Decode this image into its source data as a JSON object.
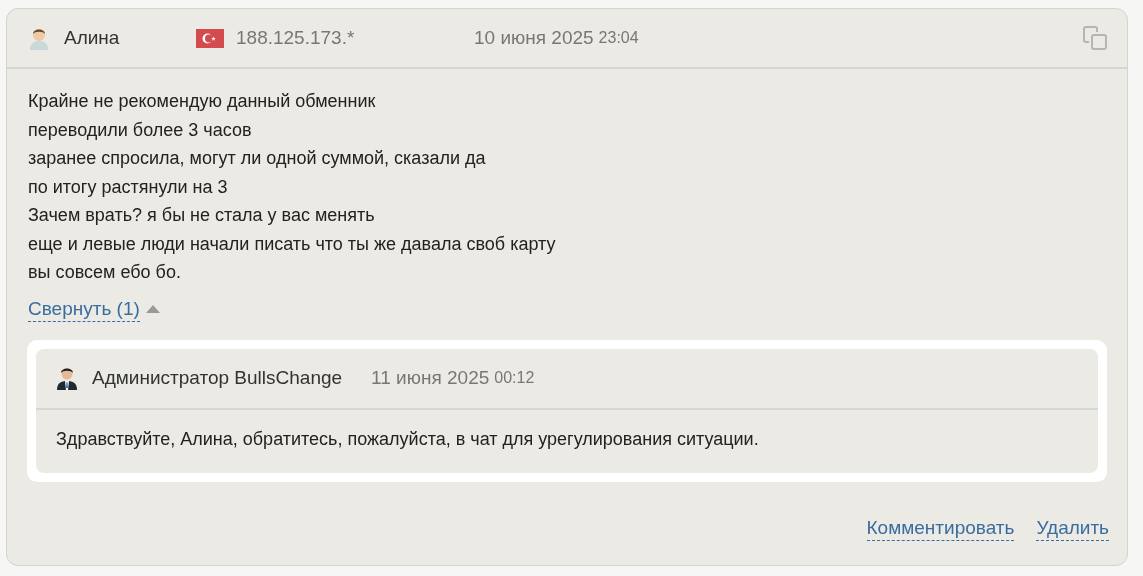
{
  "review": {
    "author": "Алина",
    "ip": "188.125.173.*",
    "date": "10 июня 2025",
    "time": "23:04",
    "lines": [
      "Крайне не рекомендую данный обменник",
      "переводили более 3 часов",
      "заранее спросила, могут ли одной суммой, сказали да",
      "по итогу растянули на 3",
      "Зачем врать? я бы не стала у вас менять",
      "еще и левые люди начали писать что ты же давала своб карту",
      "вы совсем ебо бо."
    ]
  },
  "replies_toggle": {
    "label": "Свернуть (1)",
    "expanded": true
  },
  "replies": [
    {
      "author": "Администратор BullsChange",
      "date": "11 июня 2025",
      "time": "00:12",
      "text": "Здравствуйте, Алина, обратитесь, пожалуйста, в чат для урегулирования ситуации."
    }
  ],
  "actions": [
    "Комментировать",
    "Удалить"
  ]
}
